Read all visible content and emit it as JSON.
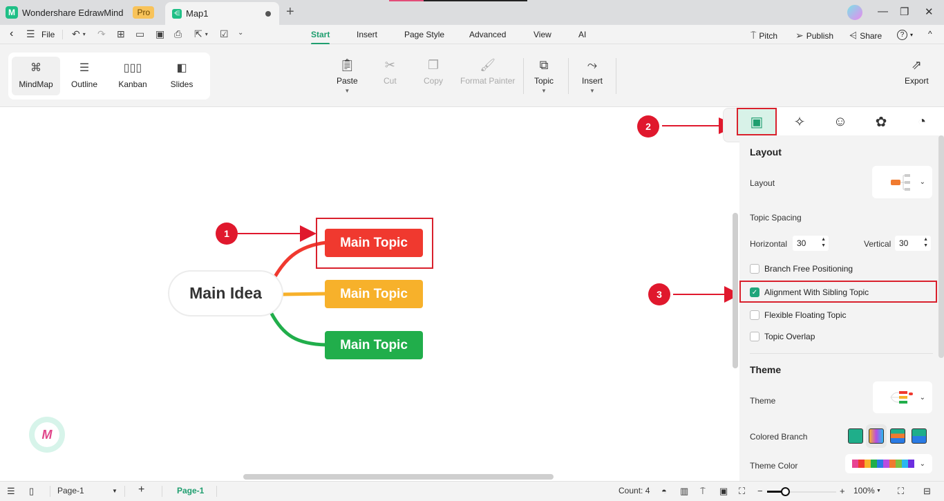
{
  "titlebar": {
    "app_name": "Wondershare EdrawMind",
    "plan_badge": "Pro",
    "doc_tab": "Map1",
    "new_tab": "+",
    "minimize": "—",
    "restore": "❐",
    "close": "✕"
  },
  "menubar": {
    "back": "‹",
    "menu": "☰",
    "file": "File",
    "tabs": [
      "Start",
      "Insert",
      "Page Style",
      "Advanced",
      "View",
      "AI"
    ],
    "active_tab": "Start",
    "right": {
      "pitch": "Pitch",
      "publish": "Publish",
      "share": "Share",
      "help": "?",
      "collapse": "^"
    }
  },
  "view_modes": [
    {
      "label": "MindMap",
      "selected": true
    },
    {
      "label": "Outline",
      "selected": false
    },
    {
      "label": "Kanban",
      "selected": false
    },
    {
      "label": "Slides",
      "selected": false
    }
  ],
  "ribbon": {
    "paste": "Paste",
    "cut": "Cut",
    "copy": "Copy",
    "format_painter": "Format Painter",
    "topic": "Topic",
    "insert": "Insert",
    "export": "Export"
  },
  "mindmap": {
    "central": "Main Idea",
    "topics": [
      {
        "label": "Main Topic",
        "color": "#f0392f"
      },
      {
        "label": "Main Topic",
        "color": "#f7b12b"
      },
      {
        "label": "Main Topic",
        "color": "#21ae4b"
      }
    ]
  },
  "annotations": {
    "step1": "1",
    "step2": "2",
    "step3": "3",
    "color": "#e0182d"
  },
  "panel": {
    "layout_heading": "Layout",
    "layout_label": "Layout",
    "topic_spacing": "Topic Spacing",
    "horizontal_label": "Horizontal",
    "horizontal_value": "30",
    "vertical_label": "Vertical",
    "vertical_value": "30",
    "checkboxes": [
      {
        "label": "Branch Free Positioning",
        "checked": false
      },
      {
        "label": "Alignment With Sibling Topic",
        "checked": true
      },
      {
        "label": "Flexible Floating Topic",
        "checked": false
      },
      {
        "label": "Topic Overlap",
        "checked": false
      }
    ],
    "theme_heading": "Theme",
    "theme_label": "Theme",
    "colored_branch": "Colored Branch",
    "theme_color": "Theme Color",
    "theme_palette": [
      "#e84393",
      "#f0392f",
      "#f7b12b",
      "#21ae4b",
      "#2a7be4",
      "#b84de0",
      "#f07a2f",
      "#7cc142",
      "#2ab7f0",
      "#6c2ee0"
    ],
    "accent": "#1f9e6f"
  },
  "statusbar": {
    "page_select": "Page-1",
    "add_page": "+",
    "active_page": "Page-1",
    "count": "Count: 4",
    "zoom": "100%",
    "zoom_minus": "−",
    "zoom_plus": "+"
  }
}
